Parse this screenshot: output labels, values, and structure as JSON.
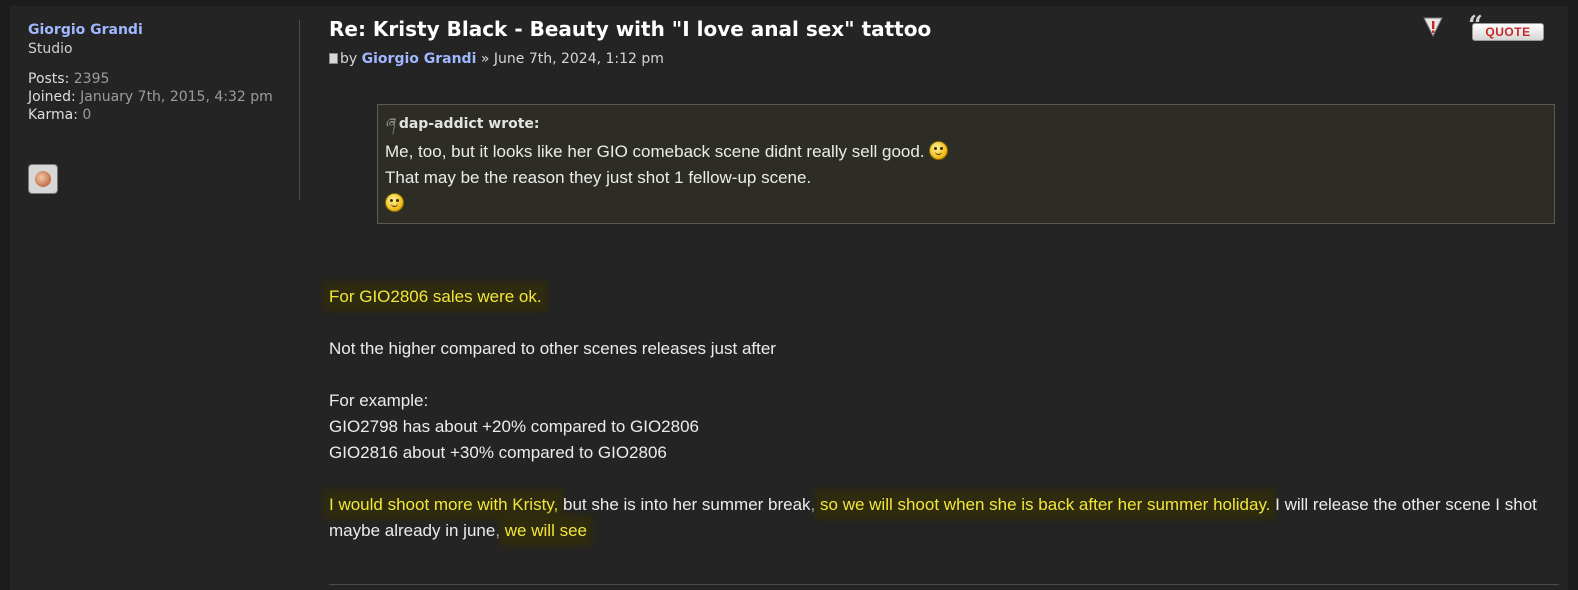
{
  "profile": {
    "username": "Giorgio Grandi",
    "rank": "Studio",
    "posts_label": "Posts:",
    "posts_value": "2395",
    "joined_label": "Joined:",
    "joined_value": "January 7th, 2015, 4:32 pm",
    "karma_label": "Karma:",
    "karma_value": "0"
  },
  "post": {
    "title": "Re: Kristy Black - Beauty with \"I love anal sex\" tattoo",
    "by_prefix": "by",
    "author": "Giorgio Grandi",
    "date_sep": "»",
    "date": "June 7th, 2024, 1:12 pm",
    "quote_button": "QUOTE"
  },
  "quote": {
    "author": "dap-addict wrote:",
    "line1": "Me, too, but it looks like her GIO comeback scene didnt really sell good.",
    "line2": "That may be the reason they just shot 1 fellow-up scene."
  },
  "body": {
    "p1": "For GIO2806 sales were ok.",
    "p2": "Not the higher compared to other scenes releases just after",
    "p3a": "For example:",
    "p3b": "GIO2798 has about +20% compared to GIO2806",
    "p3c": "GIO2816 about +30% compared to GIO2806",
    "p4_hl1": "I would shoot more with Kristy,",
    "p4_t1": " but she is into her summer break, ",
    "p4_hl2": "so we will shoot when she is back after her summer holiday.",
    "p4_t2": " I will release the other scene I shot maybe already in june, ",
    "p4_hl3": "we will see"
  },
  "colors": {
    "username": "#9fb8ff",
    "highlight_text": "#f2e63a",
    "quote_bg": "#2e2d25"
  }
}
